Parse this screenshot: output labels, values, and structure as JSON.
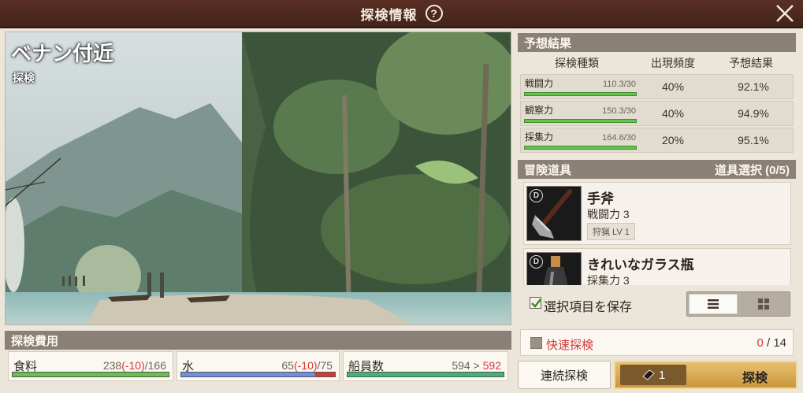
{
  "window": {
    "title": "探検情報",
    "help_icon": "?",
    "close_icon": "close-icon"
  },
  "location": {
    "name": "ベナン付近",
    "type": "探検"
  },
  "forecast": {
    "header": "予想結果",
    "columns": [
      "探検種類",
      "出現頻度",
      "予想結果"
    ],
    "rows": [
      {
        "stat": "戦闘力",
        "value": "110.3/30",
        "frequency": "40%",
        "result": "92.1%"
      },
      {
        "stat": "観察力",
        "value": "150.3/30",
        "frequency": "40%",
        "result": "94.9%"
      },
      {
        "stat": "採集力",
        "value": "164.6/30",
        "frequency": "20%",
        "result": "95.1%"
      }
    ]
  },
  "tools": {
    "header": "冒険道具",
    "select_label": "道具選択 (0/5)",
    "items": [
      {
        "grade": "D",
        "name": "手斧",
        "stat": "戦闘力 3",
        "tag": "狩猟 LV 1",
        "icon": "hand-axe-icon"
      },
      {
        "grade": "D",
        "name": "きれいなガラス瓶",
        "stat": "採集力 3",
        "tag": "",
        "icon": "glass-bottle-icon"
      }
    ],
    "save_label": "選択項目を保存",
    "save_checked": true
  },
  "cost": {
    "header": "探検費用",
    "food": {
      "label": "食料",
      "current": "238",
      "delta": "(-10)",
      "max": "/166"
    },
    "water": {
      "label": "水",
      "current": "65",
      "delta": "(-10)",
      "max": "/75"
    },
    "crew": {
      "label": "船員数",
      "from": "594 > ",
      "to": "592"
    }
  },
  "quick": {
    "label": "快速探検",
    "current": "0",
    "total": " / 14"
  },
  "buttons": {
    "continuous": "連続探検",
    "ticket_count": "1",
    "explore": "探検"
  },
  "colors": {
    "accent_gold": "#d9ab55",
    "bar_green": "#67c14b",
    "bar_blue": "#6f8fe0",
    "warn_red": "#d13a3a"
  }
}
